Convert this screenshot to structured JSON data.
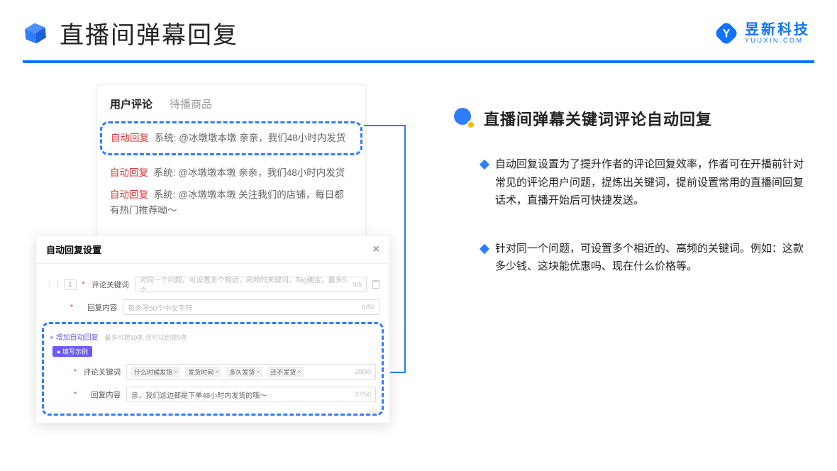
{
  "header": {
    "title": "直播间弹幕回复",
    "brand_cn": "昱新科技",
    "brand_en": "YUUXIN.COM"
  },
  "comments": {
    "tab_active": "用户评论",
    "tab_inactive": "待播商品",
    "auto_label": "自动回复",
    "sys_label": "系统:",
    "items": [
      "@冰墩墩本墩 亲亲，我们48小时内发货",
      "@冰墩墩本墩 亲亲，我们48小时内发货",
      "@冰墩墩本墩 关注我们的店铺，每日都有热门推荐呦～"
    ]
  },
  "settings": {
    "title": "自动回复设置",
    "index": "1",
    "kw_label": "评论关键词",
    "kw_placeholder": "对同一个问题，可设置多个相近，高频的关键词，Tag确定，最多5个",
    "kw_counter": "0/5",
    "reply_label": "回复内容",
    "reply_placeholder": "每条限50个中文字符",
    "reply_counter": "0/50",
    "add_link": "+ 增加自动回复",
    "hint": "最多可建10条 还可以创建9条",
    "example_badge": "● 填写示例",
    "ex_kw_label": "评论关键词",
    "ex_pills": [
      "什么时候发货",
      "发货时间",
      "多久发货",
      "还不发货"
    ],
    "ex_kw_counter": "20/50",
    "ex_reply_label": "回复内容",
    "ex_reply_value": "亲，我们这边都是下单48小时内发货的哦～",
    "ex_reply_counter": "37/50",
    "bottom_counter": "/50"
  },
  "feature": {
    "title": "直播间弹幕关键词评论自动回复",
    "bullets": [
      "自动回复设置为了提升作者的评论回复效率，作者可在开播前针对常见的评论用户问题，提炼出关键词，提前设置常用的直播间回复话术，直播开始后可快捷发送。",
      "针对同一个问题，可设置多个相近的、高频的关键词。例如：这款多少钱、这块能优惠吗、现在什么价格等。"
    ]
  }
}
